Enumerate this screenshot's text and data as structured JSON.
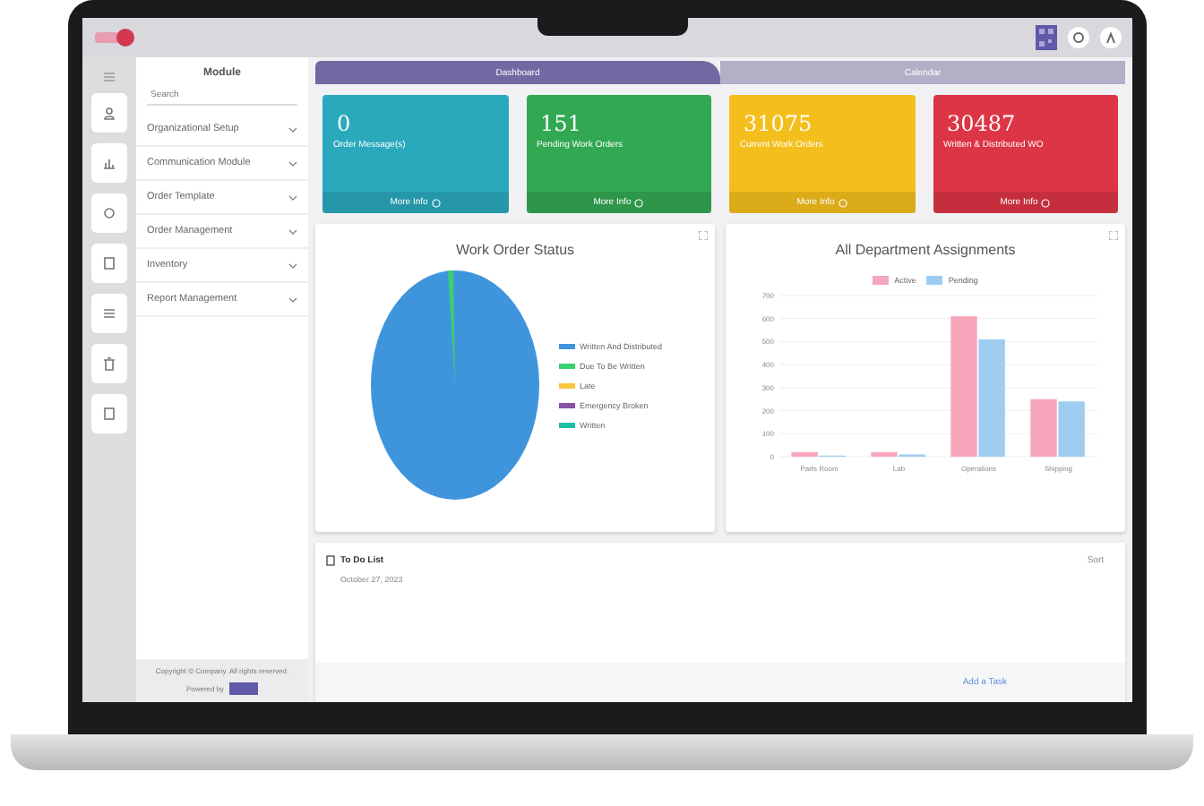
{
  "tabs": [
    {
      "label": "Dashboard",
      "selected": true
    },
    {
      "label": "Calendar",
      "selected": false
    }
  ],
  "sidebar": {
    "title": "Module",
    "search": {
      "placeholder": "Search"
    },
    "items": [
      {
        "label": "Organizational Setup"
      },
      {
        "label": "Communication Module"
      },
      {
        "label": "Order Template"
      },
      {
        "label": "Order Management"
      },
      {
        "label": "Inventory"
      },
      {
        "label": "Report Management"
      }
    ],
    "footer": "Copyright © Company. All rights reserved.",
    "powered_by": "Powered by"
  },
  "cards": [
    {
      "value": "0",
      "label": "Order Message(s)",
      "link": "More Info",
      "color": "#2aa9bd"
    },
    {
      "value": "151",
      "label": "Pending Work Orders",
      "link": "More Info",
      "color": "#33a853"
    },
    {
      "value": "31075",
      "label": "Current Work Orders",
      "link": "More Info",
      "color": "#f4bf1c"
    },
    {
      "value": "30487",
      "label": "Written & Distributed WO",
      "link": "More Info",
      "color": "#dc3545"
    }
  ],
  "pie_panel": {
    "title": "Work Order Status",
    "legend": [
      {
        "label": "Written And Distributed",
        "color": "#3f95dc"
      },
      {
        "label": "Due To Be Written",
        "color": "#3ccf6e"
      },
      {
        "label": "Late",
        "color": "#f7c63c"
      },
      {
        "label": "Emergency Broken",
        "color": "#8a4fa8"
      },
      {
        "label": "Written",
        "color": "#1fbfa3"
      }
    ]
  },
  "bar_panel": {
    "chart_data": {
      "type": "bar",
      "title": "All Department Assignments",
      "categories": [
        "Parts Room",
        "Lab",
        "Operations",
        "Shipping"
      ],
      "series": [
        {
          "name": "Active",
          "color": "#f6a5bb",
          "values": [
            20,
            20,
            610,
            250
          ]
        },
        {
          "name": "Pending",
          "color": "#9fcdf2",
          "values": [
            5,
            10,
            510,
            240
          ]
        }
      ],
      "grid": true,
      "ylim": [
        0,
        700
      ],
      "yticks": [
        0,
        100,
        200,
        300,
        400,
        500,
        600,
        700
      ]
    }
  },
  "todo": {
    "title": "To Do List",
    "date": "October 27, 2023",
    "sort": "Sort",
    "add": "Add a Task"
  }
}
